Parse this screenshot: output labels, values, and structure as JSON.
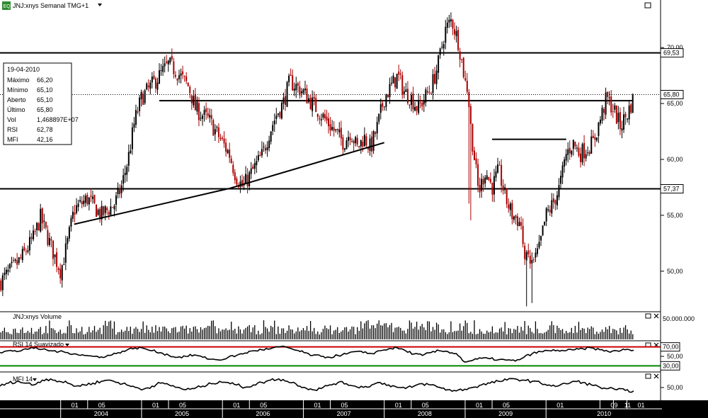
{
  "header": {
    "icon_text": "EQ",
    "symbol_label": "JNJ:xnys Semanal TMG+1"
  },
  "info_box": {
    "date": "19-04-2010",
    "rows": [
      {
        "label": "Máximo",
        "value": "66,20"
      },
      {
        "label": "Mínimo",
        "value": "65,10"
      },
      {
        "label": "Aberto",
        "value": "65,10"
      },
      {
        "label": "Último",
        "value": "65,80"
      },
      {
        "label": "Vol",
        "value": "1,468897E+07"
      },
      {
        "label": "RSI",
        "value": "62,78"
      },
      {
        "label": "MFI",
        "value": "42,16"
      }
    ]
  },
  "price_axis": {
    "ticks": [
      "70,00",
      "65,00",
      "60,00",
      "55,00",
      "50,00"
    ],
    "tags": [
      {
        "text": "69,53",
        "value": 69.53,
        "style": "solid"
      },
      {
        "text": "65,80",
        "value": 65.8,
        "style": "dotted"
      },
      {
        "text": "57,37",
        "value": 57.37,
        "style": "solid"
      }
    ]
  },
  "volume_panel": {
    "title": "JNJ:xnys Volume",
    "axis_label": "50.000.000"
  },
  "rsi_panel": {
    "title": "RSI 14 Suavizado",
    "axis_labels": [
      "70,00",
      "50,00",
      "30,00"
    ],
    "overbought_color": "#cc0000",
    "oversold_color": "#008800"
  },
  "mfi_panel": {
    "title": "MFI 14",
    "axis_label": "50,00"
  },
  "time_axis": {
    "months": [
      "01",
      "05",
      "01",
      "05",
      "01",
      "05",
      "01",
      "05",
      "01",
      "05",
      "01",
      "05",
      "01",
      "09",
      "11",
      "01"
    ],
    "years": [
      "2004",
      "2005",
      "2006",
      "2007",
      "2008",
      "2009",
      "2010"
    ]
  },
  "colors": {
    "up": "#000000",
    "down": "#aa0000",
    "background": "#ffffff",
    "axis_bar": "#000000"
  },
  "chart_data": {
    "type": "candlestick",
    "ylim": [
      46.5,
      73.5
    ],
    "grid": false,
    "horizontal_levels": [
      69.53,
      65.25,
      57.37
    ],
    "trendlines": [
      {
        "from": [
          "2004-03",
          54.2
        ],
        "to": [
          "2006-02",
          57.4
        ]
      },
      {
        "from": [
          "2006-02",
          57.4
        ],
        "to": [
          "2008-01",
          61.5
        ]
      },
      {
        "from": [
          "2009-05",
          61.8
        ],
        "to": [
          "2010-04",
          61.8
        ]
      }
    ],
    "price_path": [
      [
        "2003-04",
        49.0
      ],
      [
        "2003-07",
        51.0
      ],
      [
        "2003-09",
        53.0
      ],
      [
        "2003-10",
        54.8
      ],
      [
        "2003-12",
        51.5
      ],
      [
        "2004-01",
        50.0
      ],
      [
        "2004-02",
        52.5
      ],
      [
        "2004-03",
        55.5
      ],
      [
        "2004-05",
        56.5
      ],
      [
        "2004-07",
        55.0
      ],
      [
        "2004-09",
        56.0
      ],
      [
        "2004-10",
        57.5
      ],
      [
        "2004-11",
        60.0
      ],
      [
        "2004-12",
        63.5
      ],
      [
        "2005-01",
        65.5
      ],
      [
        "2005-03",
        67.0
      ],
      [
        "2005-05",
        68.5
      ],
      [
        "2005-06",
        68.0
      ],
      [
        "2005-08",
        66.5
      ],
      [
        "2005-09",
        64.5
      ],
      [
        "2005-11",
        63.5
      ],
      [
        "2006-01",
        61.5
      ],
      [
        "2006-02",
        60.5
      ],
      [
        "2006-03",
        58.5
      ],
      [
        "2006-04",
        57.5
      ],
      [
        "2006-05",
        58.5
      ],
      [
        "2006-07",
        60.5
      ],
      [
        "2006-08",
        62.5
      ],
      [
        "2006-09",
        64.0
      ],
      [
        "2006-10",
        65.0
      ],
      [
        "2006-11",
        67.0
      ],
      [
        "2007-01",
        66.0
      ],
      [
        "2007-03",
        64.5
      ],
      [
        "2007-05",
        63.0
      ],
      [
        "2007-07",
        61.5
      ],
      [
        "2007-08",
        62.5
      ],
      [
        "2007-09",
        61.0
      ],
      [
        "2007-10",
        62.0
      ],
      [
        "2007-11",
        61.0
      ],
      [
        "2007-12",
        63.0
      ],
      [
        "2008-01",
        65.5
      ],
      [
        "2008-03",
        67.5
      ],
      [
        "2008-04",
        66.0
      ],
      [
        "2008-05",
        65.5
      ],
      [
        "2008-06",
        64.5
      ],
      [
        "2008-07",
        65.5
      ],
      [
        "2008-08",
        66.5
      ],
      [
        "2008-09",
        68.5
      ],
      [
        "2008-10",
        71.5
      ],
      [
        "2008-11",
        72.5
      ],
      [
        "2008-12",
        70.5
      ],
      [
        "2009-01",
        67.0
      ],
      [
        "2009-02",
        62.0
      ],
      [
        "2009-03",
        57.0
      ],
      [
        "2009-04",
        59.0
      ],
      [
        "2009-05",
        57.5
      ],
      [
        "2009-06",
        59.0
      ],
      [
        "2009-07",
        56.5
      ],
      [
        "2009-08",
        55.0
      ],
      [
        "2009-09",
        54.5
      ],
      [
        "2009-10",
        51.0
      ],
      [
        "2009-11",
        50.5
      ],
      [
        "2009-12",
        52.0
      ],
      [
        "2010-01",
        55.0
      ],
      [
        "2010-02",
        56.0
      ],
      [
        "2010-03",
        57.5
      ],
      [
        "2010-04",
        60.5
      ],
      [
        "2010-05",
        61.5
      ],
      [
        "2010-06",
        60.5
      ],
      [
        "2010-07",
        61.0
      ],
      [
        "2010-08",
        61.5
      ],
      [
        "2010-09",
        63.5
      ],
      [
        "2010-10",
        65.5
      ],
      [
        "2010-11",
        64.5
      ],
      [
        "2010-12",
        63.0
      ],
      [
        "2011-01",
        64.0
      ],
      [
        "2011-02",
        65.5
      ]
    ],
    "rsi_path": [
      58,
      62,
      60,
      66,
      67,
      65,
      62,
      60,
      58,
      55,
      52,
      50,
      49,
      52,
      58,
      63,
      68,
      67,
      62,
      58,
      52,
      48,
      50,
      53,
      48,
      44,
      42,
      48,
      52,
      57,
      62,
      64,
      66,
      70,
      69,
      63,
      58,
      52,
      50,
      48,
      52,
      55,
      60,
      58,
      56,
      62,
      66,
      68,
      62,
      55,
      52,
      58,
      62,
      60,
      56,
      38,
      42,
      46,
      45,
      43,
      42,
      40,
      48,
      56,
      60,
      62,
      63,
      62,
      64,
      66,
      68,
      64,
      60,
      62,
      64,
      63
    ],
    "mfi_path": [
      50,
      55,
      58,
      55,
      52,
      60,
      62,
      58,
      55,
      50,
      52,
      55,
      58,
      60,
      56,
      52,
      48,
      45,
      50,
      55,
      52,
      48,
      44,
      46,
      50,
      54,
      58,
      56,
      52,
      48,
      52,
      56,
      60,
      62,
      58,
      54,
      48,
      44,
      46,
      52,
      56,
      54,
      50,
      48,
      52,
      56,
      52,
      48,
      46,
      50,
      54,
      52,
      48,
      44,
      42,
      45,
      48,
      52,
      55,
      58,
      60,
      62,
      60,
      58,
      55,
      52,
      50,
      54,
      58,
      56,
      52,
      48,
      46,
      44,
      43,
      42
    ]
  }
}
